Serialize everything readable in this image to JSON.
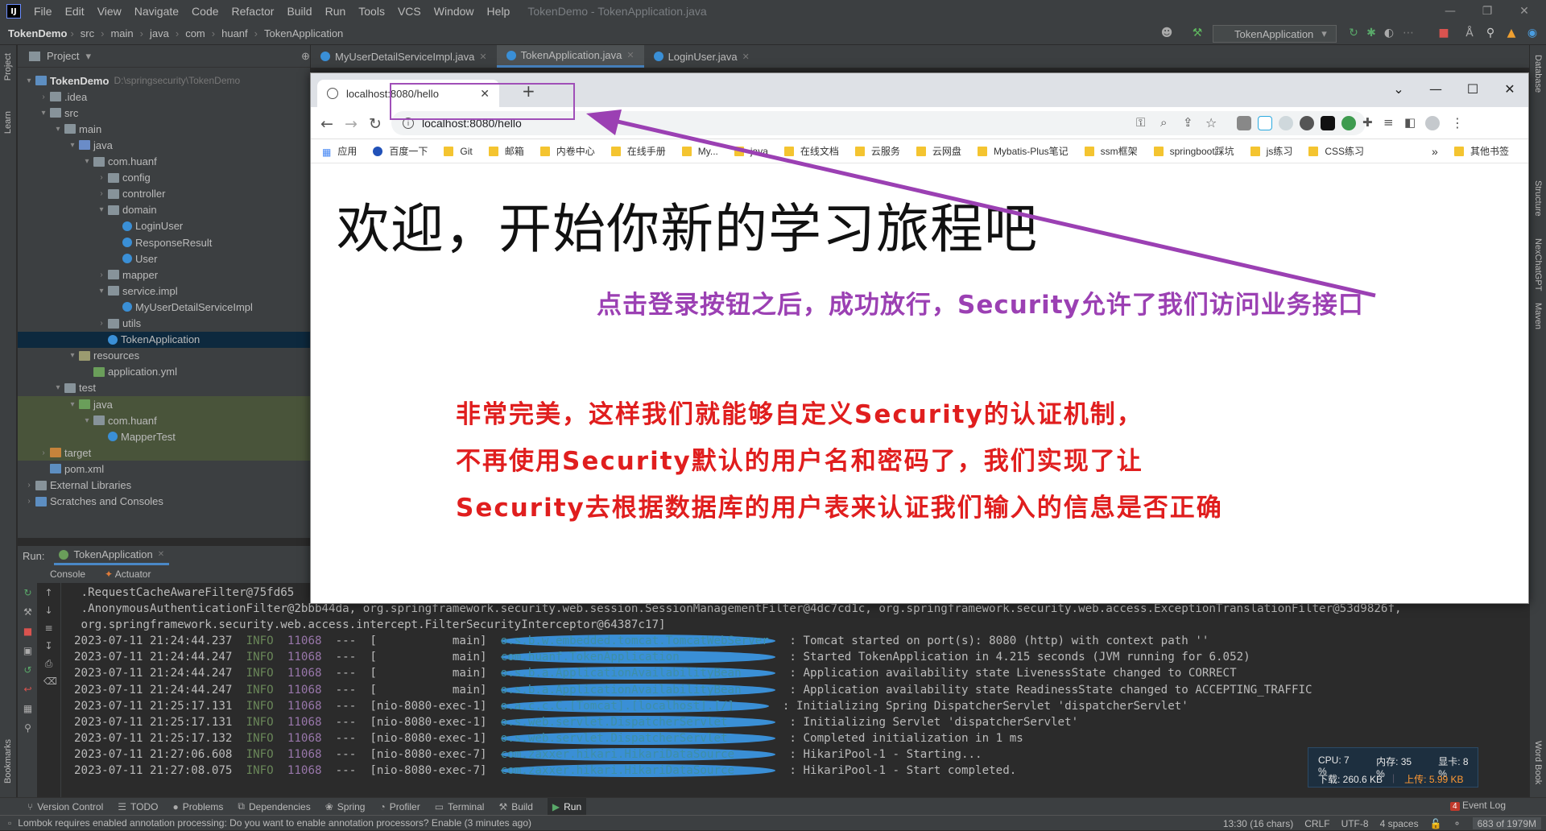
{
  "menubar": {
    "items": [
      "File",
      "Edit",
      "View",
      "Navigate",
      "Code",
      "Refactor",
      "Build",
      "Run",
      "Tools",
      "VCS",
      "Window",
      "Help"
    ],
    "title": "TokenDemo - TokenApplication.java"
  },
  "breadcrumb": {
    "project": "TokenDemo",
    "parts": [
      "src",
      "main",
      "java",
      "com",
      "huanf"
    ],
    "file": "TokenApplication"
  },
  "run_config": "TokenApplication",
  "left_strip": {
    "project": "Project",
    "learn": "Learn",
    "bookmarks": "Bookmarks"
  },
  "right_strip": {
    "database": "Database",
    "structure": "Structure",
    "nexchat": "NexChatGPT",
    "maven": "Maven",
    "wordbook": "Word Book"
  },
  "project_panel": {
    "title": "Project",
    "tree": [
      {
        "label": "TokenDemo",
        "path": "D:\\springsecurity\\TokenDemo"
      },
      {
        "label": ".idea"
      },
      {
        "label": "src"
      },
      {
        "label": "main"
      },
      {
        "label": "java"
      },
      {
        "label": "com.huanf"
      },
      {
        "label": "config"
      },
      {
        "label": "controller"
      },
      {
        "label": "domain"
      },
      {
        "label": "LoginUser"
      },
      {
        "label": "ResponseResult"
      },
      {
        "label": "User"
      },
      {
        "label": "mapper"
      },
      {
        "label": "service.impl"
      },
      {
        "label": "MyUserDetailServiceImpl"
      },
      {
        "label": "utils"
      },
      {
        "label": "TokenApplication"
      },
      {
        "label": "resources"
      },
      {
        "label": "application.yml"
      },
      {
        "label": "test"
      },
      {
        "label": "java"
      },
      {
        "label": "com.huanf"
      },
      {
        "label": "MapperTest"
      },
      {
        "label": "target"
      },
      {
        "label": "pom.xml"
      },
      {
        "label": "External Libraries"
      },
      {
        "label": "Scratches and Consoles"
      }
    ]
  },
  "editor_tabs": [
    {
      "label": "MyUserDetailServiceImpl.java"
    },
    {
      "label": "TokenApplication.java"
    },
    {
      "label": "LoginUser.java"
    }
  ],
  "browser": {
    "tab_title": "localhost:8080/hello",
    "url": "localhost:8080/hello",
    "bookmarks": [
      "应用",
      "百度一下",
      "Git",
      "邮箱",
      "内卷中心",
      "在线手册",
      "My...",
      "java",
      "在线文档",
      "云服务",
      "云网盘",
      "Mybatis-Plus笔记",
      "ssm框架",
      "springboot踩坑",
      "js练习",
      "CSS练习"
    ],
    "bookmarks_more": "»",
    "bookmarks_other": "其他书签",
    "heading": "欢迎，开始你新的学习旅程吧"
  },
  "annotations": {
    "purple": "点击登录按钮之后，成功放行，Security允许了我们访问业务接口",
    "red": [
      "非常完美，这样我们就能够自定义Security的认证机制，",
      "不再使用Security默认的用户名和密码了，我们实现了让",
      "Security去根据数据库的用户表来认证我们输入的信息是否正确"
    ]
  },
  "run_panel": {
    "label": "Run:",
    "tab": "TokenApplication",
    "subtabs": [
      "Console",
      "Actuator"
    ],
    "pre_lines": [
      " .RequestCacheAwareFilter@75fd65",
      " .AnonymousAuthenticationFilter@2bbb44da, org.springframework.security.web.session.SessionManagementFilter@4dc7cd1c, org.springframework.security.web.access.ExceptionTranslationFilter@53d9826f,",
      " org.springframework.security.web.access.intercept.FilterSecurityInterceptor@64387c17]"
    ],
    "log_lines": [
      {
        "ts": "2023-07-11 21:24:44.237",
        "level": "INFO",
        "pid": "11068",
        "thread": "---  [           main]",
        "logger": "o.s.b.w.embedded.tomcat.TomcatWebServer ",
        "msg": ": Tomcat started on port(s): 8080 (http) with context path ''"
      },
      {
        "ts": "2023-07-11 21:24:44.247",
        "level": "INFO",
        "pid": "11068",
        "thread": "---  [           main]",
        "logger": "com.huanf.TokenApplication              ",
        "msg": ": Started TokenApplication in 4.215 seconds (JVM running for 6.052)"
      },
      {
        "ts": "2023-07-11 21:24:44.247",
        "level": "INFO",
        "pid": "11068",
        "thread": "---  [           main]",
        "logger": "o.s.b.a.ApplicationAvailabilityBean     ",
        "msg": ": Application availability state LivenessState changed to CORRECT"
      },
      {
        "ts": "2023-07-11 21:24:44.247",
        "level": "INFO",
        "pid": "11068",
        "thread": "---  [           main]",
        "logger": "o.s.b.a.ApplicationAvailabilityBean     ",
        "msg": ": Application availability state ReadinessState changed to ACCEPTING_TRAFFIC"
      },
      {
        "ts": "2023-07-11 21:25:17.131",
        "level": "INFO",
        "pid": "11068",
        "thread": "---  [nio-8080-exec-1]",
        "logger": "o.a.c.c.C.[Tomcat].[localhost].[/]     ",
        "msg": ": Initializing Spring DispatcherServlet 'dispatcherServlet'"
      },
      {
        "ts": "2023-07-11 21:25:17.131",
        "level": "INFO",
        "pid": "11068",
        "thread": "---  [nio-8080-exec-1]",
        "logger": "o.s.web.servlet.DispatcherServlet       ",
        "msg": ": Initializing Servlet 'dispatcherServlet'"
      },
      {
        "ts": "2023-07-11 21:25:17.132",
        "level": "INFO",
        "pid": "11068",
        "thread": "---  [nio-8080-exec-1]",
        "logger": "o.s.web.servlet.DispatcherServlet       ",
        "msg": ": Completed initialization in 1 ms"
      },
      {
        "ts": "2023-07-11 21:27:06.608",
        "level": "INFO",
        "pid": "11068",
        "thread": "---  [nio-8080-exec-7]",
        "logger": "com.zaxxer.hikari.HikariDataSource      ",
        "msg": ": HikariPool-1 - Starting..."
      },
      {
        "ts": "2023-07-11 21:27:08.075",
        "level": "INFO",
        "pid": "11068",
        "thread": "---  [nio-8080-exec-7]",
        "logger": "com.zaxxer.hikari.HikariDataSource      ",
        "msg": ": HikariPool-1 - Start completed."
      }
    ]
  },
  "perf": {
    "cpu": "CPU: 7 %",
    "mem": "内存: 35 %",
    "gpu": "显卡: 8 %",
    "down": "下载: 260.6 KB",
    "up": "上传: 5.99 KB"
  },
  "tool_windows": [
    "Version Control",
    "TODO",
    "Problems",
    "Dependencies",
    "Spring",
    "Profiler",
    "Terminal",
    "Build",
    "Run"
  ],
  "event_log": "Event Log",
  "event_log_count": "4",
  "status": {
    "message": "Lombok requires enabled annotation processing: Do you want to enable annotation processors? Enable (3 minutes ago)",
    "position": "13:30 (16 chars)",
    "line_sep": "CRLF",
    "encoding": "UTF-8",
    "indent": "4 spaces",
    "memory": "683 of 1979M"
  },
  "colors": {
    "accent": "#4a88c7",
    "annotation_purple": "#9b40b3",
    "annotation_red": "#e01e1e"
  }
}
